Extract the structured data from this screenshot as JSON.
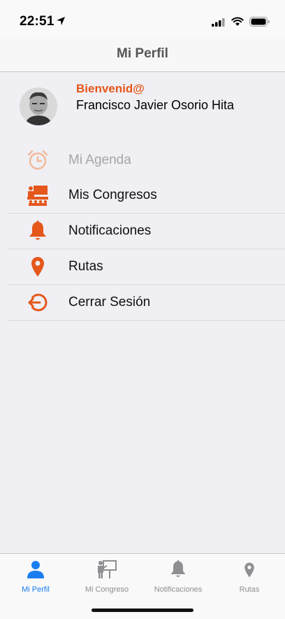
{
  "status_bar": {
    "time": "22:51"
  },
  "nav": {
    "title": "Mi Perfil"
  },
  "profile": {
    "greeting": "Bienvenid@",
    "name": "Francisco Javier Osorio Hita"
  },
  "menu": {
    "items": [
      {
        "label": "Mi Agenda",
        "icon": "alarm-clock-icon",
        "enabled": false
      },
      {
        "label": "Mis Congresos",
        "icon": "presentation-icon",
        "enabled": true
      },
      {
        "label": "Notificaciones",
        "icon": "bell-icon",
        "enabled": true
      },
      {
        "label": "Rutas",
        "icon": "map-pin-icon",
        "enabled": true
      },
      {
        "label": "Cerrar Sesión",
        "icon": "logout-icon",
        "enabled": true
      }
    ]
  },
  "tabs": [
    {
      "label": "Mi Perfil",
      "icon": "person-icon",
      "active": true
    },
    {
      "label": "Mi Congreso",
      "icon": "presentation-icon",
      "active": false
    },
    {
      "label": "Notificaciones",
      "icon": "bell-icon",
      "active": false
    },
    {
      "label": "Rutas",
      "icon": "map-pin-icon",
      "active": false
    }
  ],
  "colors": {
    "accent": "#e5571b",
    "tab_active": "#1a7ef0",
    "tab_inactive": "#8e8e93",
    "background": "#efeff4"
  }
}
